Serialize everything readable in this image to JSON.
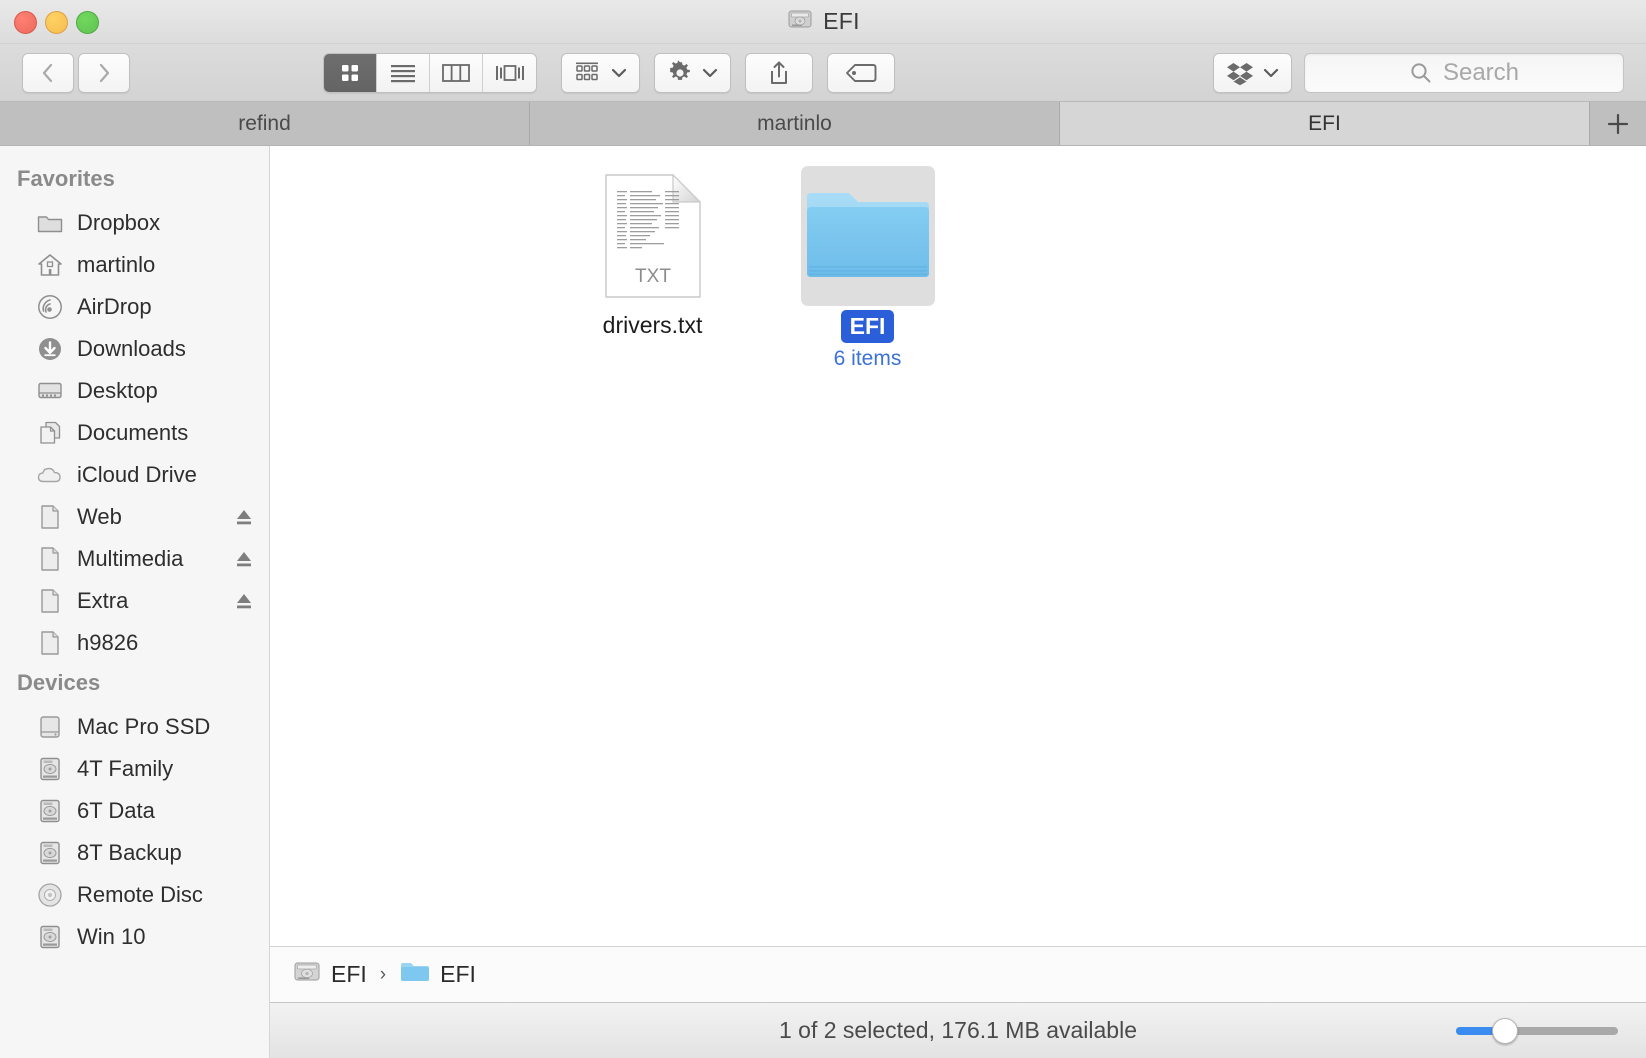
{
  "window": {
    "title": "EFI",
    "title_icon": "hard-drive-icon"
  },
  "toolbar": {
    "back_label": "‹",
    "forward_label": "›",
    "view_modes": [
      {
        "name": "icon-view",
        "label": "Icon View",
        "active": true
      },
      {
        "name": "list-view",
        "label": "List View",
        "active": false
      },
      {
        "name": "column-view",
        "label": "Column View",
        "active": false
      },
      {
        "name": "coverflow-view",
        "label": "Cover Flow View",
        "active": false
      }
    ],
    "arrange_label": "Arrange",
    "action_label": "Action",
    "share_label": "Share",
    "tag_label": "Edit Tags",
    "dropbox_label": "Dropbox"
  },
  "search": {
    "placeholder": "Search",
    "value": ""
  },
  "tabs": {
    "items": [
      {
        "label": "refind",
        "active": false
      },
      {
        "label": "martinlo",
        "active": false
      },
      {
        "label": "EFI",
        "active": true
      }
    ],
    "add_label": "+"
  },
  "sidebar": {
    "sections": [
      {
        "header": "Favorites",
        "items": [
          {
            "label": "Dropbox",
            "icon": "folder-icon",
            "eject": false
          },
          {
            "label": "martinlo",
            "icon": "home-icon",
            "eject": false
          },
          {
            "label": "AirDrop",
            "icon": "airdrop-icon",
            "eject": false
          },
          {
            "label": "Downloads",
            "icon": "downloads-icon",
            "eject": false
          },
          {
            "label": "Desktop",
            "icon": "desktop-icon",
            "eject": false
          },
          {
            "label": "Documents",
            "icon": "documents-icon",
            "eject": false
          },
          {
            "label": "iCloud Drive",
            "icon": "cloud-icon",
            "eject": false
          },
          {
            "label": "Web",
            "icon": "page-icon",
            "eject": true
          },
          {
            "label": "Multimedia",
            "icon": "page-icon",
            "eject": true
          },
          {
            "label": "Extra",
            "icon": "page-icon",
            "eject": true
          },
          {
            "label": "h9826",
            "icon": "page-icon",
            "eject": false
          }
        ]
      },
      {
        "header": "Devices",
        "items": [
          {
            "label": "Mac Pro SSD",
            "icon": "internal-drive-icon",
            "eject": false
          },
          {
            "label": "4T Family",
            "icon": "external-drive-icon",
            "eject": false
          },
          {
            "label": "6T Data",
            "icon": "external-drive-icon",
            "eject": false
          },
          {
            "label": "8T Backup",
            "icon": "external-drive-icon",
            "eject": false
          },
          {
            "label": "Remote Disc",
            "icon": "optical-disc-icon",
            "eject": false
          },
          {
            "label": "Win 10",
            "icon": "external-drive-icon",
            "eject": false
          }
        ]
      }
    ]
  },
  "files": [
    {
      "name": "drivers.txt",
      "icon": "txt-document-icon",
      "badge": "TXT",
      "selected": false,
      "subtitle": ""
    },
    {
      "name": "EFI",
      "icon": "folder-icon",
      "badge": "",
      "selected": true,
      "subtitle": "6 items"
    }
  ],
  "pathbar": {
    "segments": [
      {
        "label": "EFI",
        "icon": "hard-drive-icon"
      },
      {
        "label": "EFI",
        "icon": "folder-icon"
      }
    ],
    "separator": "›"
  },
  "statusbar": {
    "text": "1 of 2 selected, 176.1 MB available",
    "zoom_percent": 22
  },
  "colors": {
    "selection_blue": "#2a5fd9",
    "subtitle_blue": "#3b72d8",
    "folder_blue": "#6dc2f0",
    "slider_blue": "#3b8cf0"
  }
}
